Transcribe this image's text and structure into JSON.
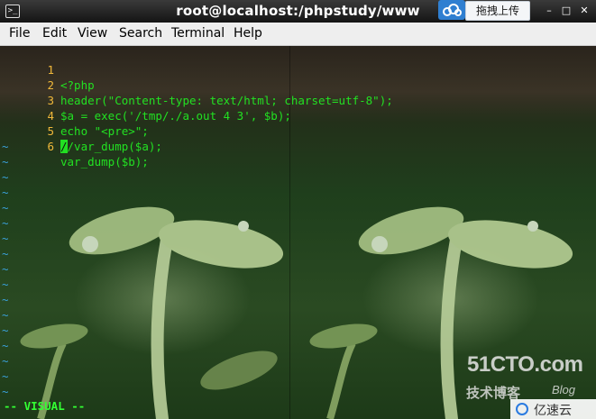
{
  "window": {
    "title": "root@localhost:/phpstudy/www",
    "terminal_icon": "terminal-icon",
    "upload_label": "拖拽上传",
    "cloud_icon": "cloud-icon",
    "controls": {
      "minimize": "–",
      "maximize": "□",
      "close": "✕"
    }
  },
  "menu": [
    "File",
    "Edit",
    "View",
    "Search",
    "Terminal",
    "Help"
  ],
  "editor": {
    "lines": [
      {
        "num": "1",
        "text": "<?php"
      },
      {
        "num": "2",
        "text": "header(\"Content-type: text/html; charset=utf-8\");"
      },
      {
        "num": "3",
        "text": "$a = exec('/tmp/./a.out 4 3', $b);"
      },
      {
        "num": "4",
        "text": "echo \"<pre>\";"
      },
      {
        "num": "5",
        "text_before": "",
        "cursor_char": "/",
        "text_after": "/var_dump($a);"
      },
      {
        "num": "6",
        "text": "var_dump($b);"
      }
    ],
    "empty_marker": "~",
    "mode": "-- VISUAL --"
  },
  "watermark": {
    "site": "51CTO.com",
    "subtitle": "技术博客",
    "blog": "Blog",
    "brand": "亿速云"
  },
  "colors": {
    "line_number": "#f0b83a",
    "code": "#22e022",
    "tilde": "#3aa0d8",
    "mode": "#33ff33"
  }
}
